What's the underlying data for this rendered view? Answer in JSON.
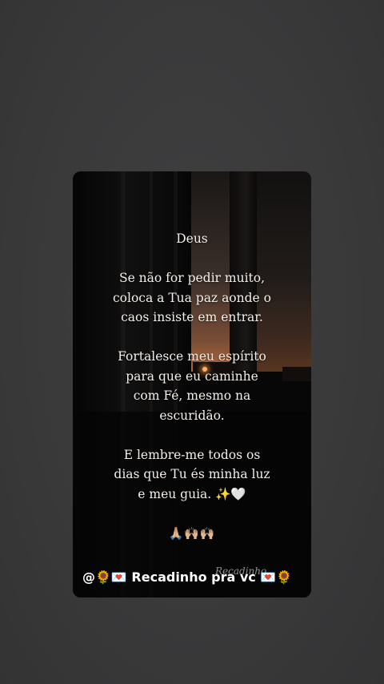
{
  "post": {
    "title": "Deus",
    "paragraph_1": "Se não for pedir muito,\ncoloca a Tua paz aonde o\ncaos insiste em entrar.",
    "paragraph_2": "Fortalesce meu espírito\npara que eu caminhe\ncom Fé, mesmo na\nescuridão.",
    "paragraph_3": "E lembre-me todos os\ndias que Tu és minha luz\ne meu guia. ✨🤍",
    "emojis": "🙏🏼🙌🏼🙌🏼"
  },
  "footer": {
    "handle": "@🌻💌 Recadinho pra vc 💌🌻",
    "watermark": "Recadinho"
  },
  "colors": {
    "page_background": "#3a3a3b",
    "card_background": "#070707",
    "text": "#f4efe9",
    "sunset": "#e07a3a"
  }
}
